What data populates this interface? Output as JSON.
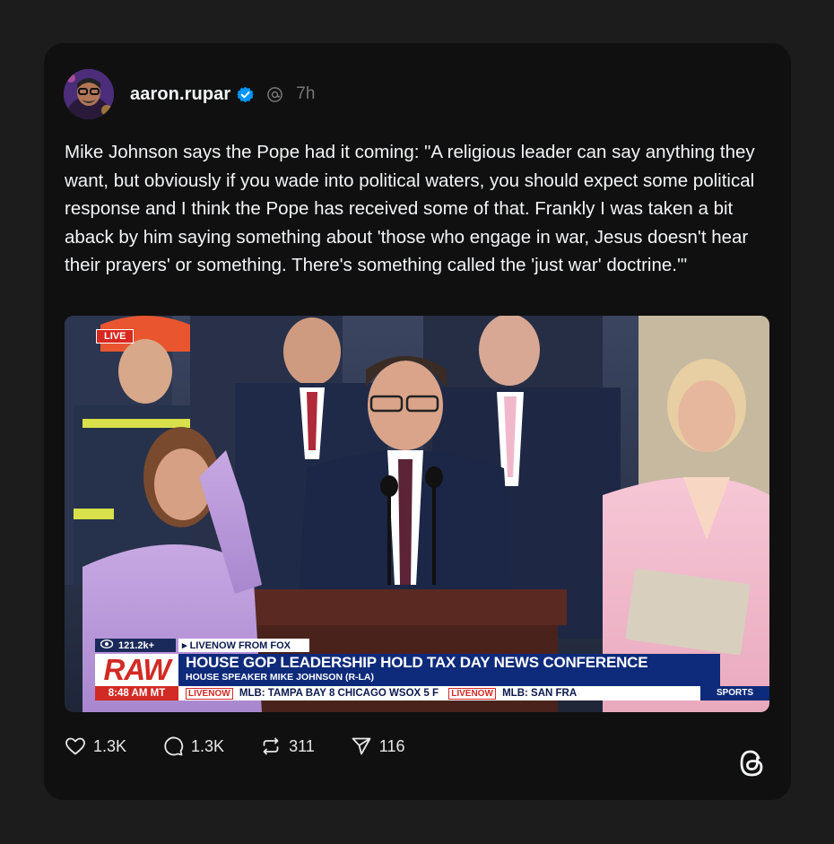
{
  "post": {
    "username": "aaron.rupar",
    "time": "7h",
    "text": "Mike Johnson says the Pope had it coming: \"A religious leader can say anything they want, but obviously if you wade into political waters, you should expect some political response and I think the Pope has received some of that. Frankly I was taken a bit aback by him saying something about 'those who engage in war, Jesus doesn't hear their prayers' or something. There's something called the 'just war' doctrine.'\""
  },
  "media": {
    "live_tag": "LIVE",
    "views": "121.2k+",
    "source": "▸ LIVENOW FROM FOX",
    "raw_logo": "RAW",
    "headline": "HOUSE GOP LEADERSHIP HOLD TAX DAY NEWS CONFERENCE",
    "subhead": "HOUSE SPEAKER MIKE JOHNSON (R-LA)",
    "clock": "8:48 AM MT",
    "ticker_badge": "LIVENOW",
    "ticker_text": "MLB:  TAMPA BAY  8  CHICAGO WSOX  5  F",
    "ticker_badge_2": "LIVENOW",
    "ticker_text_2": "MLB:  SAN FRA",
    "sports": "SPORTS"
  },
  "actions": {
    "likes": "1.3K",
    "replies": "1.3K",
    "reposts": "311",
    "shares": "116"
  },
  "icons": {
    "verified": "verified-badge-icon",
    "threads": "threads-logo-icon",
    "like": "heart-icon",
    "reply": "comment-icon",
    "repost": "repost-icon",
    "share": "send-icon"
  },
  "colors": {
    "verified_blue": "#0095f6",
    "fox_blue": "#0e2a7a",
    "fox_red": "#d22a24"
  }
}
